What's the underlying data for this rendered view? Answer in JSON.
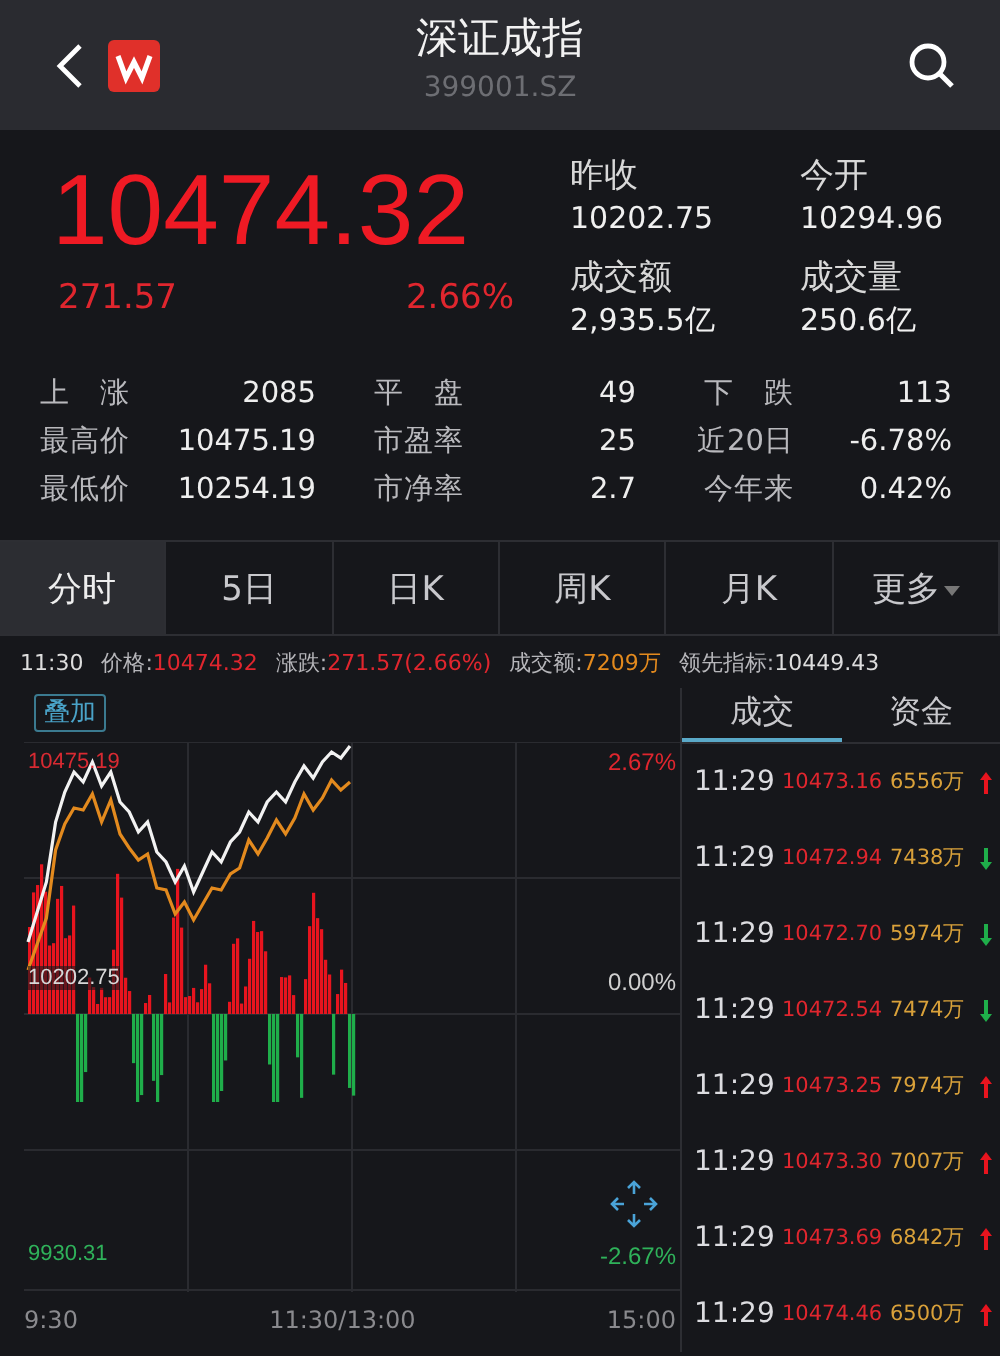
{
  "header": {
    "title": "深证成指",
    "code": "399001.SZ"
  },
  "quote": {
    "price": "10474.32",
    "change": "271.57",
    "change_pct": "2.66%",
    "stats": [
      {
        "label": "昨收",
        "value": "10202.75"
      },
      {
        "label": "今开",
        "value": "10294.96"
      },
      {
        "label": "成交额",
        "value": "2,935.5亿"
      },
      {
        "label": "成交量",
        "value": "250.6亿"
      }
    ]
  },
  "breadth": [
    [
      {
        "label": "上　涨",
        "value": "2085"
      },
      {
        "label": "平　盘",
        "value": "49"
      },
      {
        "label": "下　跌",
        "value": "113"
      }
    ],
    [
      {
        "label": "最高价",
        "value": "10475.19"
      },
      {
        "label": "市盈率",
        "value": "25"
      },
      {
        "label": "近20日",
        "value": "-6.78%"
      }
    ],
    [
      {
        "label": "最低价",
        "value": "10254.19"
      },
      {
        "label": "市净率",
        "value": "2.7"
      },
      {
        "label": "今年来",
        "value": "0.42%"
      }
    ]
  ],
  "tabs": [
    {
      "label": "分时",
      "selected": true,
      "kind": "plain"
    },
    {
      "label": "5日",
      "selected": false,
      "kind": "plain"
    },
    {
      "label": "日K",
      "selected": false,
      "kind": "plain"
    },
    {
      "label": "周K",
      "selected": false,
      "kind": "plain"
    },
    {
      "label": "月K",
      "selected": false,
      "kind": "plain"
    },
    {
      "label": "更多",
      "selected": false,
      "kind": "dropdown"
    }
  ],
  "info_bar": {
    "time": "11:30",
    "items": [
      {
        "label": "价格:",
        "value": "10474.32",
        "color": "#e0262e"
      },
      {
        "label": "涨跌:",
        "value": "271.57(2.66%)",
        "color": "#e0262e"
      },
      {
        "label": "成交额:",
        "value": "7209万",
        "color": "#e38a1e"
      },
      {
        "label": "领先指标:",
        "value": "10449.43",
        "color": "#dddddd"
      }
    ]
  },
  "chart": {
    "overlay_button": "叠加",
    "high_price": "10475.19",
    "base_price": "10202.75",
    "low_price": "9930.31",
    "high_pct": "2.67%",
    "base_pct": "0.00%",
    "low_pct": "-2.67%",
    "times": [
      "9:30",
      "11:30/13:00",
      "15:00"
    ]
  },
  "panel": {
    "tabs": [
      {
        "label": "成交",
        "selected": true
      },
      {
        "label": "资金",
        "selected": false
      }
    ],
    "trades": [
      {
        "time": "11:29",
        "price": "10473.16",
        "volume": "6556万",
        "rising": true
      },
      {
        "time": "11:29",
        "price": "10472.94",
        "volume": "7438万",
        "rising": false
      },
      {
        "time": "11:29",
        "price": "10472.70",
        "volume": "5974万",
        "rising": false
      },
      {
        "time": "11:29",
        "price": "10472.54",
        "volume": "7474万",
        "rising": false
      },
      {
        "time": "11:29",
        "price": "10473.25",
        "volume": "7974万",
        "rising": true
      },
      {
        "time": "11:29",
        "price": "10473.30",
        "volume": "7007万",
        "rising": true
      },
      {
        "time": "11:29",
        "price": "10473.69",
        "volume": "6842万",
        "rising": true
      },
      {
        "time": "11:29",
        "price": "10474.46",
        "volume": "6500万",
        "rising": true
      }
    ]
  }
}
